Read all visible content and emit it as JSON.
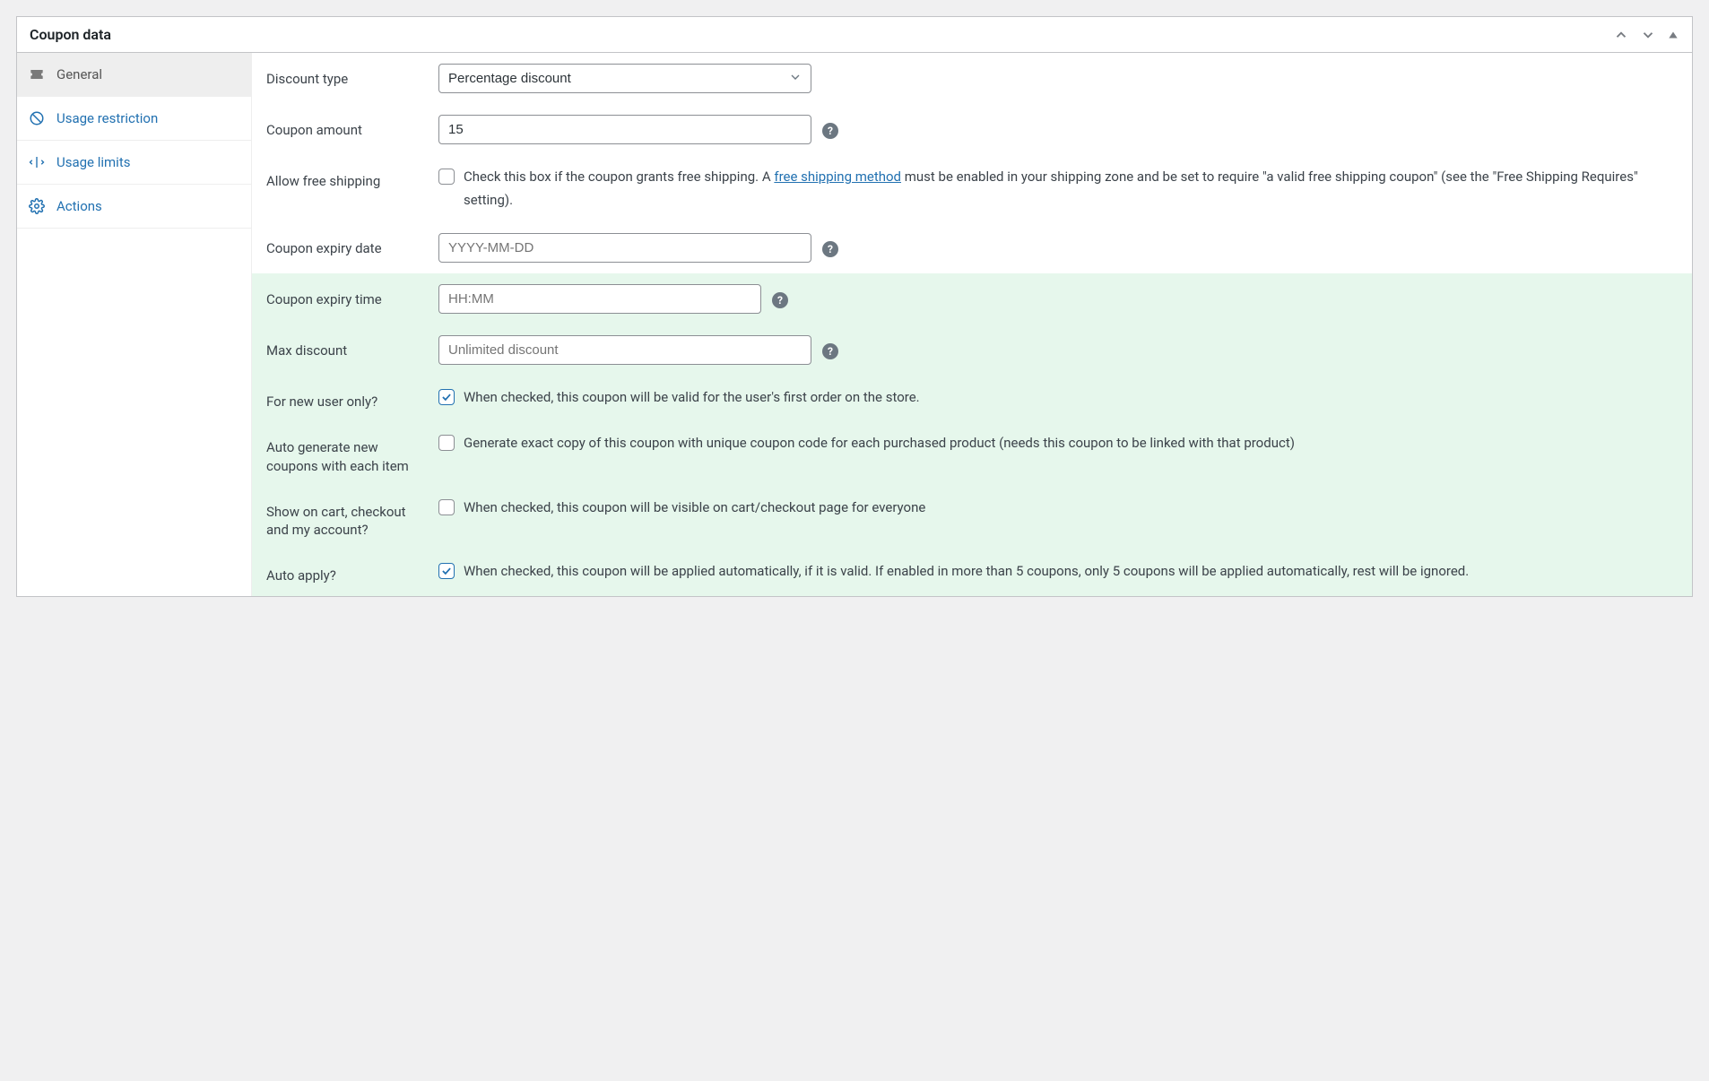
{
  "panel": {
    "title": "Coupon data"
  },
  "sidebar": {
    "items": [
      {
        "label": "General"
      },
      {
        "label": "Usage restriction"
      },
      {
        "label": "Usage limits"
      },
      {
        "label": "Actions"
      }
    ]
  },
  "fields": {
    "discount_type": {
      "label": "Discount type",
      "value": "Percentage discount"
    },
    "coupon_amount": {
      "label": "Coupon amount",
      "value": "15"
    },
    "free_shipping": {
      "label": "Allow free shipping",
      "desc_pre": "Check this box if the coupon grants free shipping. A ",
      "link": "free shipping method",
      "desc_post": " must be enabled in your shipping zone and be set to require \"a valid free shipping coupon\" (see the \"Free Shipping Requires\" setting)."
    },
    "expiry_date": {
      "label": "Coupon expiry date",
      "placeholder": "YYYY-MM-DD"
    },
    "expiry_time": {
      "label": "Coupon expiry time",
      "placeholder": "HH:MM"
    },
    "max_discount": {
      "label": "Max discount",
      "placeholder": "Unlimited discount"
    },
    "new_user": {
      "label": "For new user only?",
      "desc": "When checked, this coupon will be valid for the user's first order on the store."
    },
    "auto_generate": {
      "label": "Auto generate new coupons with each item",
      "desc": "Generate exact copy of this coupon with unique coupon code for each purchased product (needs this coupon to be linked with that product)"
    },
    "show_on_pages": {
      "label": "Show on cart, checkout and my account?",
      "desc": "When checked, this coupon will be visible on cart/checkout page for everyone"
    },
    "auto_apply": {
      "label": "Auto apply?",
      "desc": "When checked, this coupon will be applied automatically, if it is valid. If enabled in more than 5 coupons, only 5 coupons will be applied automatically, rest will be ignored."
    }
  }
}
